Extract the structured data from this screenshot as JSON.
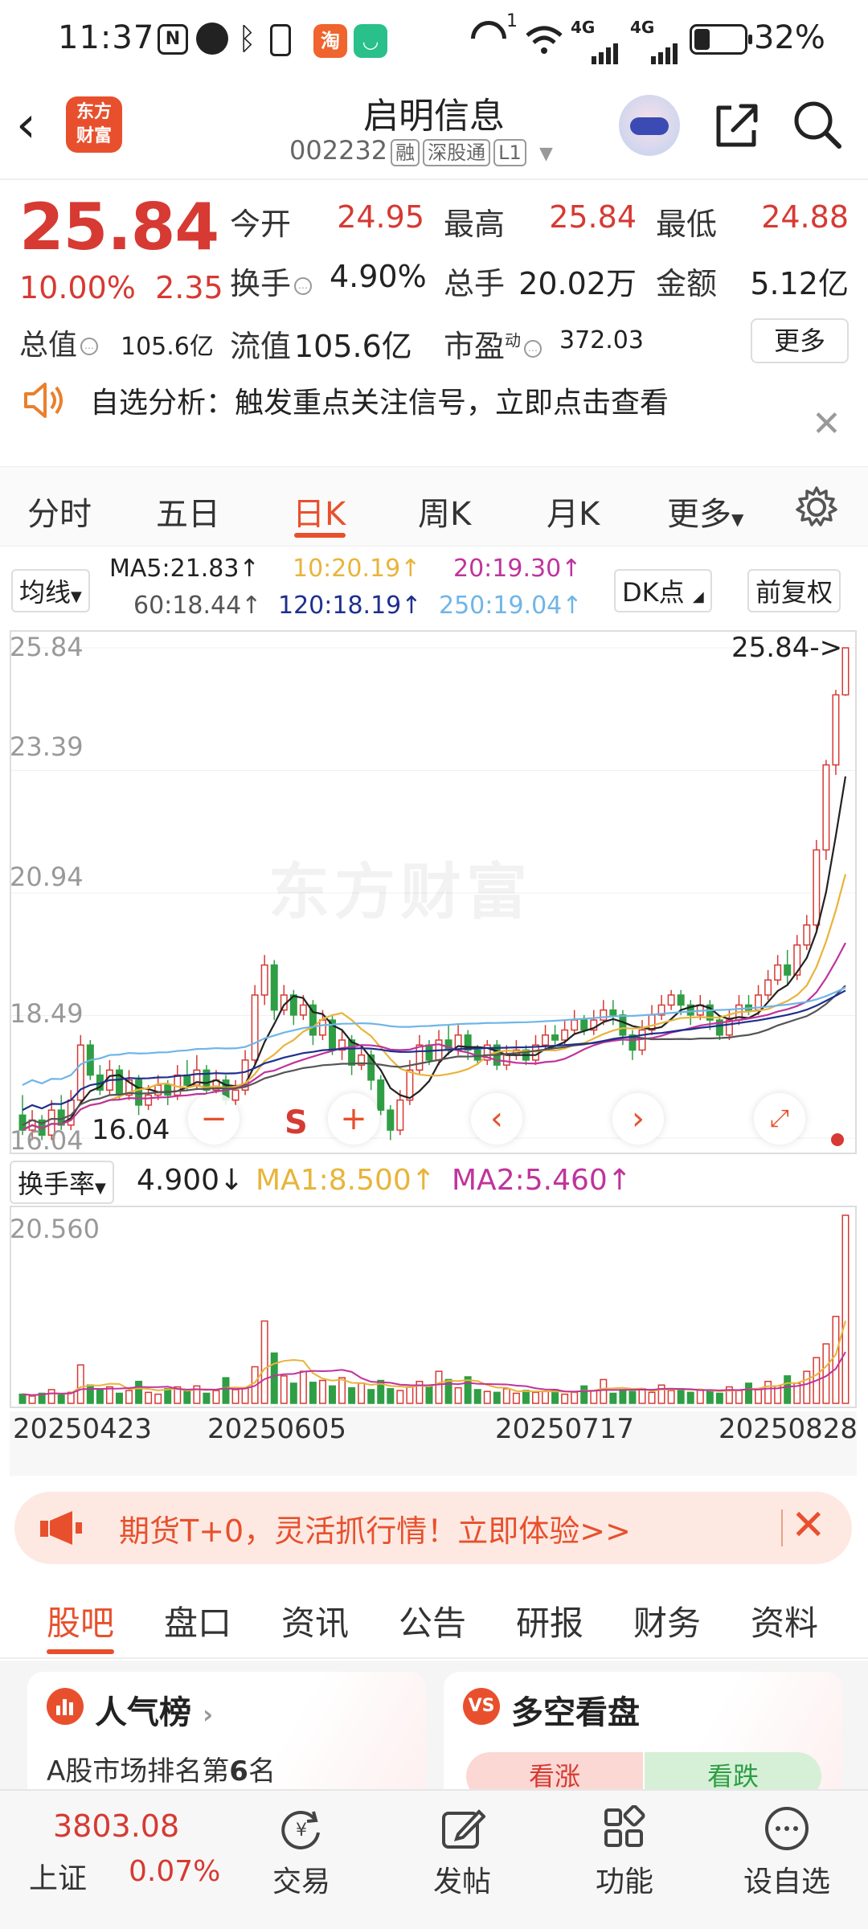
{
  "status_bar": {
    "time": "11:37",
    "signal_1": "4G",
    "signal_2": "4G",
    "battery": "32%",
    "battery_level": 0.32,
    "app_icon_1": "淘",
    "notif_sup": "1"
  },
  "header": {
    "title": "启明信息",
    "code": "002232",
    "tags": [
      "融",
      "深股通",
      "L1"
    ],
    "logo_text": [
      "东方",
      "财富"
    ]
  },
  "quote": {
    "price": "25.84",
    "change_pct": "10.00%",
    "change": "2.35",
    "stats": [
      {
        "label": "今开",
        "value": "24.95"
      },
      {
        "label": "最高",
        "value": "25.84"
      },
      {
        "label": "最低",
        "value": "24.88"
      },
      {
        "label": "换手",
        "value": "4.90%"
      },
      {
        "label": "总手",
        "value": "20.02万"
      },
      {
        "label": "金额",
        "value": "5.12亿"
      },
      {
        "label": "总值",
        "value": "105.6亿"
      },
      {
        "label": "流值",
        "value": "105.6亿"
      },
      {
        "label": "市盈",
        "value": "372.03"
      }
    ],
    "pe_sup": "动",
    "more": "更多"
  },
  "notice": {
    "text": "自选分析：触发重点关注信号，立即点击查看"
  },
  "period_tabs": [
    "分时",
    "五日",
    "日K",
    "周K",
    "月K",
    "更多"
  ],
  "active_tab": "日K",
  "ma": {
    "selector": "均线",
    "items": [
      {
        "text": "MA5:21.83↑",
        "color": "#222222"
      },
      {
        "text": "10:20.19↑",
        "color": "#e8b43a"
      },
      {
        "text": "20:19.30↑",
        "color": "#c0339c"
      },
      {
        "text": "60:18.44↑",
        "color": "#555555"
      },
      {
        "text": "120:18.19↑",
        "color": "#1e2f8e"
      },
      {
        "text": "250:19.04↑",
        "color": "#6fb5e8"
      }
    ],
    "dk_button": "DK点",
    "adjust_button": "前复权"
  },
  "chart_data": {
    "type": "candlestick",
    "y_labels": [
      "25.84",
      "23.39",
      "20.94",
      "18.49",
      "16.04"
    ],
    "ylim": [
      16.04,
      25.84
    ],
    "last_price_label": "25.84->",
    "low_label": "16.04",
    "watermark": "东方财富",
    "candles": [
      [
        16.5,
        16.2,
        16.9,
        16.1
      ],
      [
        16.2,
        16.4,
        16.6,
        16.0
      ],
      [
        16.4,
        16.1,
        16.5,
        16.0
      ],
      [
        16.1,
        16.6,
        16.8,
        16.0
      ],
      [
        16.6,
        16.3,
        16.9,
        16.2
      ],
      [
        16.3,
        16.8,
        17.0,
        16.2
      ],
      [
        16.8,
        17.9,
        18.1,
        16.7
      ],
      [
        17.9,
        17.3,
        18.0,
        17.2
      ],
      [
        17.3,
        17.0,
        17.5,
        16.9
      ],
      [
        17.0,
        17.4,
        17.6,
        16.9
      ],
      [
        17.4,
        16.9,
        17.5,
        16.8
      ],
      [
        16.9,
        17.2,
        17.4,
        16.8
      ],
      [
        17.2,
        16.7,
        17.3,
        16.5
      ],
      [
        16.7,
        16.9,
        17.1,
        16.6
      ],
      [
        16.9,
        17.1,
        17.3,
        16.8
      ],
      [
        17.1,
        16.9,
        17.2,
        16.7
      ],
      [
        16.9,
        17.3,
        17.5,
        16.8
      ],
      [
        17.3,
        17.1,
        17.6,
        17.0
      ],
      [
        17.1,
        17.4,
        17.7,
        17.0
      ],
      [
        17.4,
        17.0,
        17.5,
        16.9
      ],
      [
        17.0,
        17.2,
        17.4,
        16.9
      ],
      [
        17.2,
        16.8,
        17.3,
        16.7
      ],
      [
        16.8,
        17.0,
        17.2,
        16.7
      ],
      [
        17.0,
        17.6,
        17.8,
        16.9
      ],
      [
        17.6,
        18.9,
        19.1,
        17.5
      ],
      [
        18.9,
        19.5,
        19.7,
        18.7
      ],
      [
        19.5,
        18.6,
        19.6,
        18.4
      ],
      [
        18.6,
        18.9,
        19.1,
        18.5
      ],
      [
        18.9,
        18.5,
        19.0,
        18.3
      ],
      [
        18.5,
        18.7,
        18.9,
        18.4
      ],
      [
        18.7,
        18.1,
        18.8,
        17.9
      ],
      [
        18.1,
        18.4,
        18.6,
        18.0
      ],
      [
        18.4,
        17.8,
        18.5,
        17.7
      ],
      [
        17.8,
        18.0,
        18.2,
        17.6
      ],
      [
        18.0,
        17.5,
        18.1,
        17.3
      ],
      [
        17.5,
        17.7,
        17.9,
        17.4
      ],
      [
        17.7,
        17.2,
        17.8,
        17.0
      ],
      [
        17.2,
        16.6,
        17.3,
        16.5
      ],
      [
        16.6,
        16.2,
        16.7,
        16.0
      ],
      [
        16.2,
        16.8,
        17.0,
        16.1
      ],
      [
        16.8,
        17.4,
        17.6,
        16.7
      ],
      [
        17.4,
        17.9,
        18.1,
        17.3
      ],
      [
        17.9,
        17.6,
        18.0,
        17.5
      ],
      [
        17.6,
        18.0,
        18.2,
        17.5
      ],
      [
        18.0,
        17.8,
        18.3,
        17.7
      ],
      [
        17.8,
        18.1,
        18.3,
        17.7
      ],
      [
        18.1,
        17.8,
        18.2,
        17.6
      ],
      [
        17.8,
        17.6,
        17.9,
        17.5
      ],
      [
        17.6,
        17.9,
        18.0,
        17.5
      ],
      [
        17.9,
        17.5,
        18.0,
        17.4
      ],
      [
        17.5,
        17.7,
        17.9,
        17.4
      ],
      [
        17.7,
        17.8,
        18.0,
        17.6
      ],
      [
        17.8,
        17.6,
        17.9,
        17.5
      ],
      [
        17.6,
        17.9,
        18.1,
        17.5
      ],
      [
        17.9,
        18.1,
        18.3,
        17.8
      ],
      [
        18.1,
        18.0,
        18.3,
        17.9
      ],
      [
        18.0,
        18.2,
        18.4,
        17.9
      ],
      [
        18.2,
        18.4,
        18.6,
        18.1
      ],
      [
        18.4,
        18.2,
        18.5,
        18.1
      ],
      [
        18.2,
        18.4,
        18.6,
        18.1
      ],
      [
        18.4,
        18.6,
        18.8,
        18.3
      ],
      [
        18.6,
        18.5,
        18.8,
        18.3
      ],
      [
        18.5,
        18.1,
        18.6,
        17.9
      ],
      [
        18.1,
        17.8,
        18.2,
        17.6
      ],
      [
        17.8,
        18.2,
        18.4,
        17.7
      ],
      [
        18.2,
        18.5,
        18.7,
        18.1
      ],
      [
        18.5,
        18.7,
        18.9,
        18.4
      ],
      [
        18.7,
        18.9,
        19.0,
        18.6
      ],
      [
        18.9,
        18.7,
        19.0,
        18.5
      ],
      [
        18.7,
        18.5,
        18.8,
        18.3
      ],
      [
        18.5,
        18.7,
        18.9,
        18.4
      ],
      [
        18.7,
        18.4,
        18.8,
        18.2
      ],
      [
        18.4,
        18.1,
        18.5,
        18.0
      ],
      [
        18.1,
        18.4,
        18.6,
        18.0
      ],
      [
        18.4,
        18.7,
        18.9,
        18.3
      ],
      [
        18.7,
        18.6,
        18.9,
        18.5
      ],
      [
        18.6,
        18.9,
        19.1,
        18.5
      ],
      [
        18.9,
        19.2,
        19.4,
        18.8
      ],
      [
        19.2,
        19.5,
        19.7,
        19.1
      ],
      [
        19.5,
        19.3,
        19.8,
        19.1
      ],
      [
        19.3,
        19.9,
        20.1,
        19.2
      ],
      [
        19.9,
        20.3,
        20.5,
        19.8
      ],
      [
        20.3,
        21.8,
        22.0,
        20.2
      ],
      [
        21.8,
        23.5,
        23.6,
        21.6
      ],
      [
        23.5,
        24.9,
        25.0,
        23.3
      ],
      [
        24.9,
        25.84,
        25.84,
        24.88
      ]
    ],
    "volume": {
      "label_selector": "换手率",
      "value": "4.900↓",
      "ma1": "MA1:8.500↑",
      "ma2": "MA2:5.460↑",
      "max_label": "20.560",
      "ylim": [
        0,
        20.56
      ],
      "bars": [
        1.0,
        0.8,
        1.1,
        1.5,
        0.9,
        1.2,
        4.2,
        2.0,
        1.5,
        1.8,
        1.1,
        1.4,
        2.4,
        1.2,
        1.0,
        1.6,
        1.8,
        1.3,
        1.9,
        1.1,
        1.4,
        2.8,
        1.5,
        1.7,
        4.0,
        9.0,
        5.5,
        3.0,
        2.2,
        3.5,
        2.3,
        2.5,
        1.9,
        2.8,
        1.7,
        2.2,
        1.5,
        2.5,
        1.6,
        1.4,
        1.8,
        2.4,
        2.0,
        3.5,
        2.6,
        1.7,
        2.9,
        1.5,
        1.3,
        1.2,
        1.6,
        1.1,
        1.4,
        1.2,
        1.3,
        1.5,
        1.0,
        1.2,
        1.9,
        1.4,
        2.6,
        1.1,
        1.5,
        1.3,
        1.6,
        1.2,
        2.0,
        1.4,
        1.6,
        1.2,
        1.5,
        1.3,
        1.1,
        1.8,
        1.4,
        2.2,
        1.6,
        2.4,
        1.9,
        3.0,
        2.2,
        3.5,
        5.0,
        6.5,
        9.5,
        20.56
      ],
      "ma1_color": "#e8b43a",
      "ma2_color": "#c0339c"
    },
    "x_labels": [
      "20250423",
      "20250605",
      "20250717",
      "20250828"
    ]
  },
  "chart_controls": {
    "minus": "−",
    "s_label": "S",
    "plus": "+",
    "prev": "‹",
    "next": "›"
  },
  "banner": {
    "text": "期货T+0，灵活抓行情！立即体验>>"
  },
  "sections": [
    "股吧",
    "盘口",
    "资讯",
    "公告",
    "研报",
    "财务",
    "资料"
  ],
  "active_section": "股吧",
  "cards": [
    {
      "title": "人气榜",
      "subtitle_prefix": "A股市场排名第",
      "rank": "6",
      "subtitle_suffix": "名"
    },
    {
      "title": "多空看盘",
      "bull": "看涨",
      "bear": "看跌"
    }
  ],
  "bottom_bar": {
    "index_value": "3803.08",
    "index_name": "上证",
    "index_change": "0.07%",
    "items": [
      "交易",
      "发帖",
      "功能",
      "设自选"
    ]
  }
}
